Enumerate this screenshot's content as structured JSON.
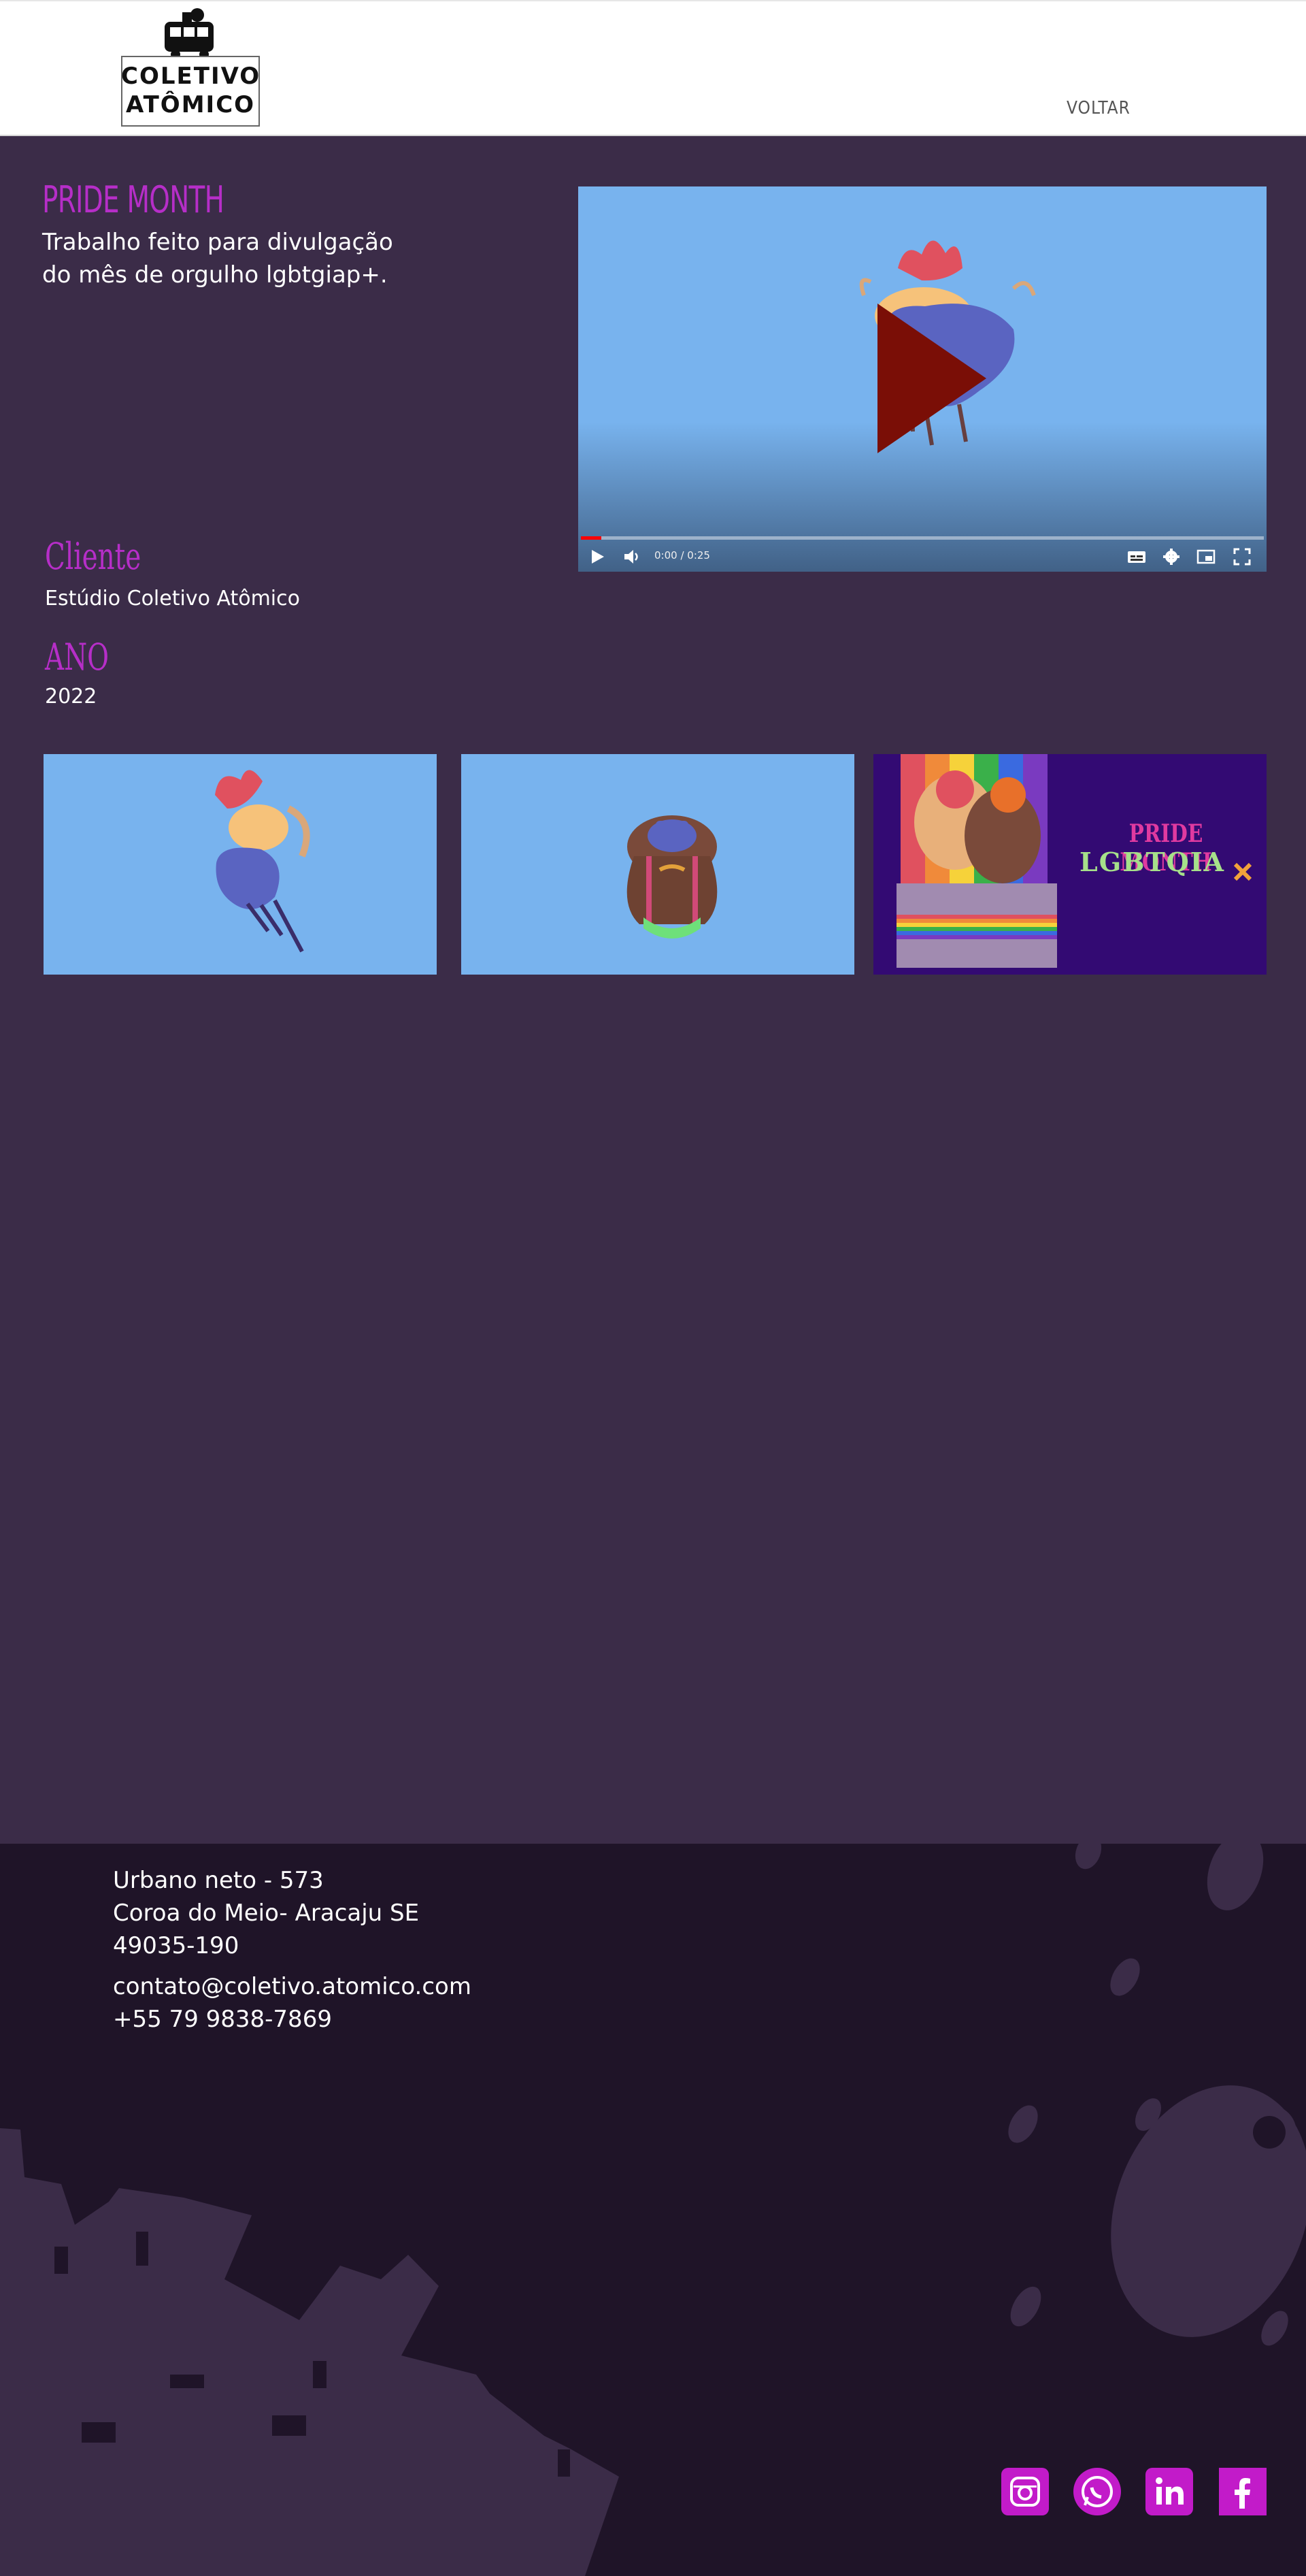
{
  "header": {
    "logo_text_line1": "COLETIVO",
    "logo_text_line2": "ATÔMICO",
    "back_link": "VOLTAR"
  },
  "project": {
    "title": "PRIDE MONTH",
    "description": "Trabalho feito para divulgação do mês de orgulho lgbtgiap+.",
    "client_label": "Cliente",
    "client_value": "Estúdio Coletivo Atômico",
    "year_label": "ANO",
    "year_value": "2022"
  },
  "video": {
    "time": "0:00 / 0:25",
    "progress_fraction": 0.03,
    "background": "#78b3ee",
    "icons": [
      "play-icon",
      "volume-icon",
      "subtitles-icon",
      "settings-icon",
      "miniplayer-icon",
      "fullscreen-icon"
    ]
  },
  "gallery": {
    "thumb3_title": "PRIDE MONTH",
    "thumb3_subtitle": "LGBTQIA"
  },
  "footer": {
    "address_line1": "Urbano neto - 573",
    "address_line2": "Coroa do Meio- Aracaju SE",
    "address_line3": "49035-190",
    "email": "contato@coletivo.atomico.com",
    "phone": "+55 79 9838-7869",
    "social": [
      "instagram-icon",
      "whatsapp-icon",
      "linkedin-icon",
      "facebook-icon"
    ]
  },
  "colors": {
    "page_bg": "#3b2c48",
    "accent": "#b62ec8",
    "footer_bg": "#1f1428",
    "social": "#c21bc9"
  }
}
